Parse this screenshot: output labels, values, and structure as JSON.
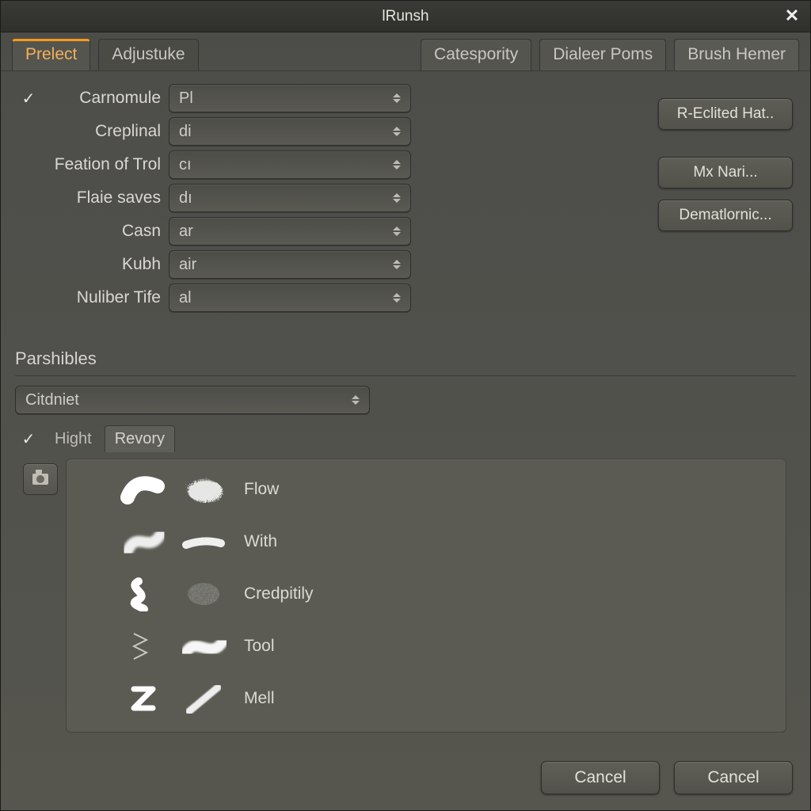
{
  "window": {
    "title": "lRunsh"
  },
  "tabs": {
    "left": [
      {
        "label": "Prelect",
        "active": true
      },
      {
        "label": "Adjustuke"
      }
    ],
    "right": [
      {
        "label": "Catespority"
      },
      {
        "label": "Dialeer Poms"
      },
      {
        "label": "Brush Hemer"
      }
    ]
  },
  "form": [
    {
      "checked": true,
      "label": "Carnomule",
      "value": "Pl"
    },
    {
      "checked": false,
      "label": "Creplinal",
      "value": "di"
    },
    {
      "checked": false,
      "label": "Feation of Trol",
      "value": "cı"
    },
    {
      "checked": false,
      "label": "Flaie saves",
      "value": "dı"
    },
    {
      "checked": false,
      "label": "Casn",
      "value": "ar"
    },
    {
      "checked": false,
      "label": "Kubh",
      "value": "air"
    },
    {
      "checked": false,
      "label": "Nuliber Tife",
      "value": "al"
    }
  ],
  "side_buttons": [
    "R-Eclited Hat..",
    "Mx Nari...",
    "Dematlornic..."
  ],
  "section": {
    "title": "Parshibles",
    "combo_value": "Citdniet"
  },
  "subtabs": [
    {
      "label": "Hight",
      "checked": true
    },
    {
      "label": "Revory",
      "active": true
    }
  ],
  "brushes": [
    {
      "label": "Flow"
    },
    {
      "label": "With"
    },
    {
      "label": "Credpitily"
    },
    {
      "label": "Tool"
    },
    {
      "label": "Mell"
    }
  ],
  "footer": {
    "primary": "Cancel",
    "secondary": "Cancel"
  }
}
